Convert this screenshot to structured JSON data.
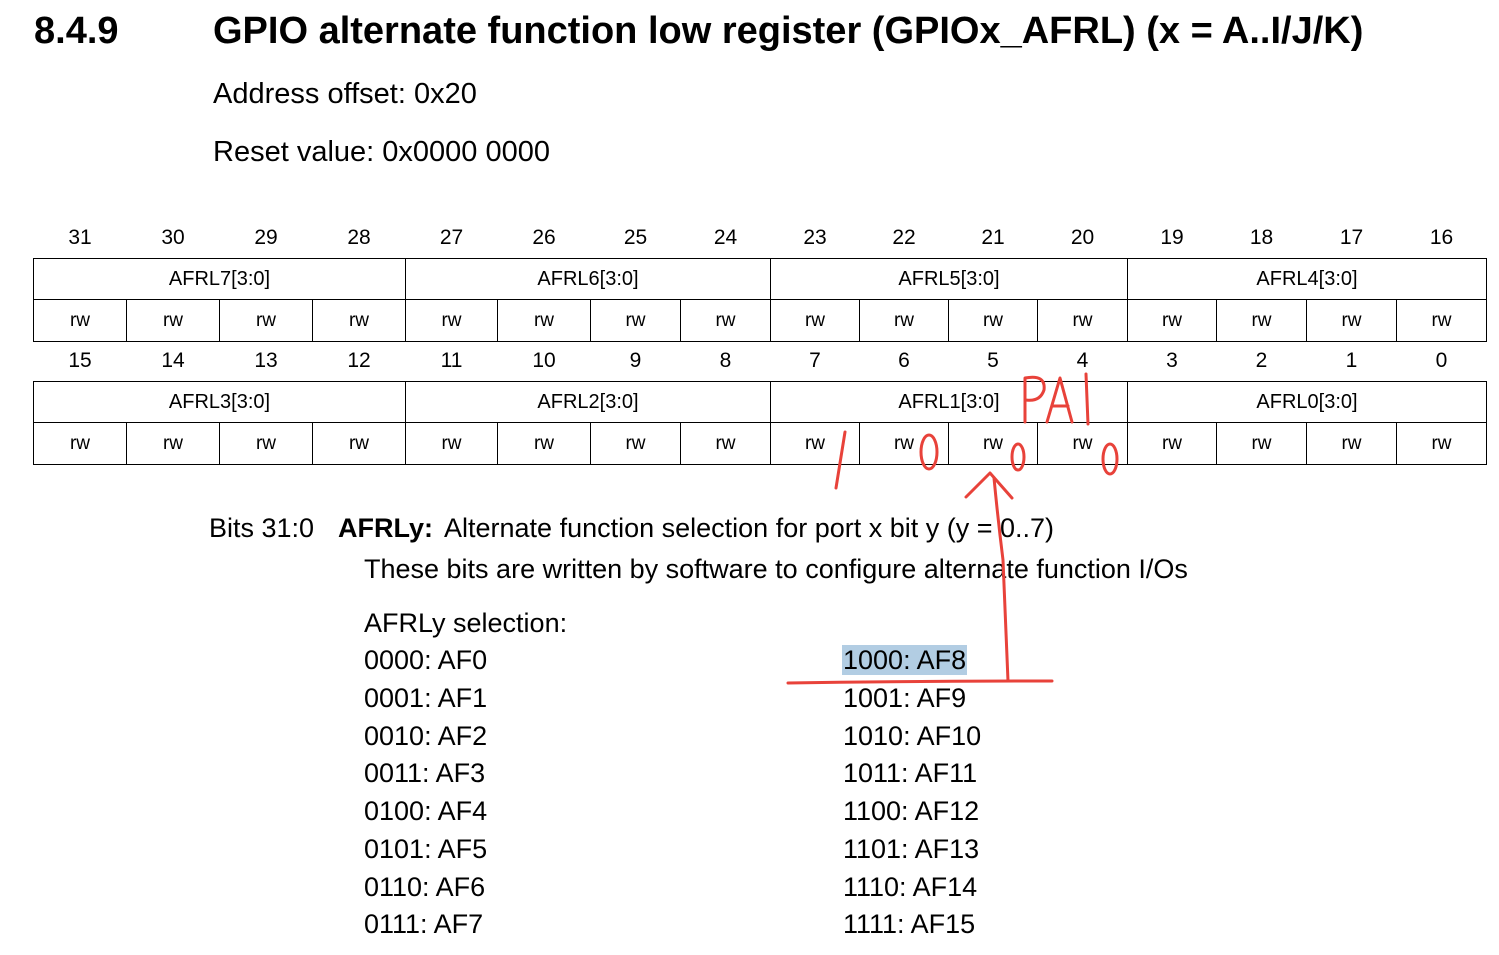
{
  "heading": {
    "number": "8.4.9",
    "title": "GPIO alternate function low register (GPIOx_AFRL) (x = A..I/J/K)"
  },
  "address_offset": "Address offset: 0x20",
  "reset_value": "Reset value: 0x0000 0000",
  "register_upper": {
    "bits": [
      "31",
      "30",
      "29",
      "28",
      "27",
      "26",
      "25",
      "24",
      "23",
      "22",
      "21",
      "20",
      "19",
      "18",
      "17",
      "16"
    ],
    "fields": [
      "AFRL7[3:0]",
      "AFRL6[3:0]",
      "AFRL5[3:0]",
      "AFRL4[3:0]"
    ],
    "access": [
      "rw",
      "rw",
      "rw",
      "rw",
      "rw",
      "rw",
      "rw",
      "rw",
      "rw",
      "rw",
      "rw",
      "rw",
      "rw",
      "rw",
      "rw",
      "rw"
    ]
  },
  "register_lower": {
    "bits": [
      "15",
      "14",
      "13",
      "12",
      "11",
      "10",
      "9",
      "8",
      "7",
      "6",
      "5",
      "4",
      "3",
      "2",
      "1",
      "0"
    ],
    "fields": [
      "AFRL3[3:0]",
      "AFRL2[3:0]",
      "AFRL1[3:0]",
      "AFRL0[3:0]"
    ],
    "access": [
      "rw",
      "rw",
      "rw",
      "rw",
      "rw",
      "rw",
      "rw",
      "rw",
      "rw",
      "rw",
      "rw",
      "rw",
      "rw",
      "rw",
      "rw",
      "rw"
    ]
  },
  "description": {
    "bits_label": "Bits 31:0",
    "field_name": "AFRLy:",
    "summary": "Alternate function selection for port x bit y (y = 0..7)",
    "detail": "These bits are written by software to configure alternate function I/Os"
  },
  "selection": {
    "label": "AFRLy selection:",
    "left": [
      "0000: AF0",
      "0001: AF1",
      "0010: AF2",
      "0011: AF3",
      "0100: AF4",
      "0101: AF5",
      "0110: AF6",
      "0111: AF7"
    ],
    "right": [
      "1000: AF8",
      "1001: AF9",
      "1010: AF10",
      "1011: AF11",
      "1100: AF12",
      "1101: AF13",
      "1110: AF14",
      "1111: AF15"
    ],
    "highlighted": "1000: AF8"
  },
  "annotations": {
    "color": "#e8423a",
    "pin_label": "PA1",
    "written_bits": [
      "1",
      "0",
      "0",
      "0"
    ]
  }
}
